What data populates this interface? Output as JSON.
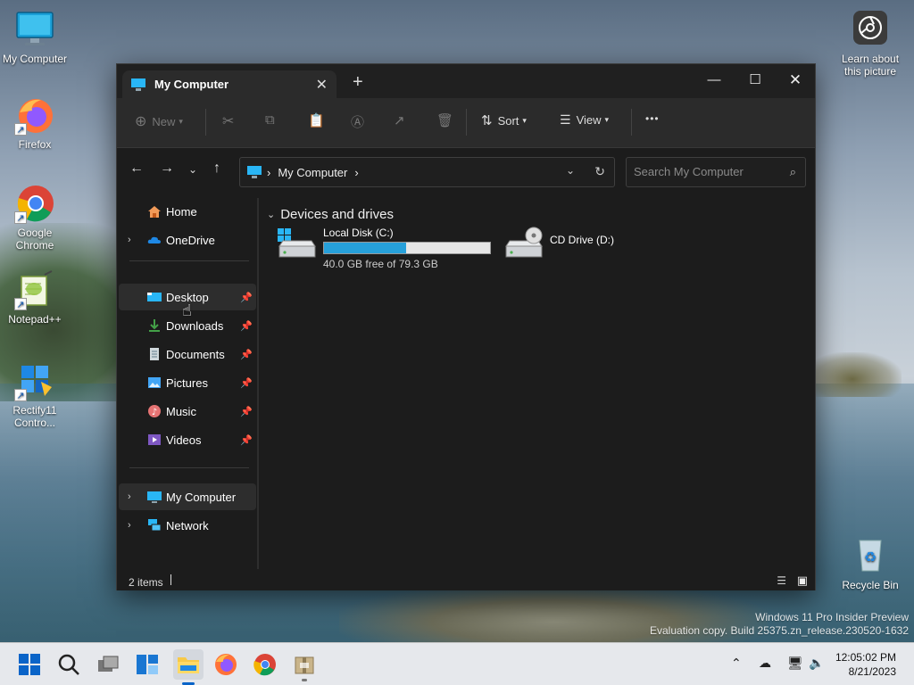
{
  "desktop": {
    "icons": [
      {
        "label": "My Computer",
        "icon": "monitor-icon"
      },
      {
        "label": "Firefox",
        "icon": "firefox-icon"
      },
      {
        "label": "Google Chrome",
        "icon": "chrome-icon"
      },
      {
        "label": "Notepad++",
        "icon": "notepadpp-icon"
      },
      {
        "label": "Rectify11 Contro...",
        "icon": "control-panel-icon"
      },
      {
        "label": "Learn about this picture",
        "icon": "camera-icon"
      },
      {
        "label": "Recycle Bin",
        "icon": "recycle-bin-icon"
      }
    ],
    "watermark_line1": "Windows 11 Pro Insider Preview",
    "watermark_line2": "Evaluation copy. Build 25375.zn_release.230520-1632"
  },
  "window": {
    "tab_title": "My Computer",
    "tab_close": "✕",
    "new_tab": "+",
    "controls": {
      "minimize": "—",
      "maximize": "☐",
      "close": "✕"
    },
    "toolbar": {
      "new_label": "New",
      "sort_label": "Sort",
      "view_label": "View",
      "more_label": "•••"
    },
    "address": {
      "path": "My Computer",
      "sep": "›",
      "search_placeholder": "Search My Computer"
    },
    "nav": [
      {
        "label": "Home",
        "icon": "home-icon"
      },
      {
        "label": "OneDrive",
        "icon": "onedrive-icon"
      },
      {
        "label": "Desktop",
        "icon": "desktop-folder-icon",
        "pinned": true
      },
      {
        "label": "Downloads",
        "icon": "download-icon",
        "pinned": true
      },
      {
        "label": "Documents",
        "icon": "document-icon",
        "pinned": true
      },
      {
        "label": "Pictures",
        "icon": "pictures-icon",
        "pinned": true
      },
      {
        "label": "Music",
        "icon": "music-icon",
        "pinned": true
      },
      {
        "label": "Videos",
        "icon": "video-icon",
        "pinned": true
      },
      {
        "label": "My Computer",
        "icon": "computer-icon"
      },
      {
        "label": "Network",
        "icon": "network-icon"
      }
    ],
    "content": {
      "group_header": "Devices and drives",
      "drives": [
        {
          "name": "Local Disk (C:)",
          "free_text": "40.0 GB free of 79.3 GB",
          "used_fraction": 0.4956
        },
        {
          "name": "CD Drive (D:)"
        }
      ]
    },
    "status": {
      "items": "2 items"
    }
  },
  "taskbar": {
    "time": "12:05:02 PM",
    "date": "8/21/2023",
    "accent": "#0a64c8"
  }
}
